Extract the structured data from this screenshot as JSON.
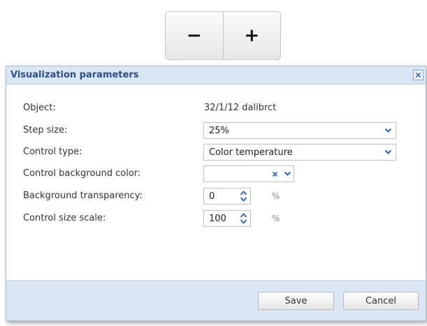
{
  "stepper": {
    "minus_label": "−",
    "plus_label": "+"
  },
  "dialog": {
    "title": "Visualization parameters",
    "fields": {
      "object": {
        "label": "Object:",
        "value": "32/1/12 dalibrct"
      },
      "step_size": {
        "label": "Step size:",
        "value": "25%"
      },
      "control_type": {
        "label": "Control type:",
        "value": "Color temperature"
      },
      "bg_color": {
        "label": "Control background color:",
        "value": ""
      },
      "bg_transparency": {
        "label": "Background transparency:",
        "value": "0",
        "unit": "%"
      },
      "size_scale": {
        "label": "Control size scale:",
        "value": "100",
        "unit": "%"
      }
    },
    "buttons": {
      "save": "Save",
      "cancel": "Cancel"
    }
  },
  "colors": {
    "title_bar": "#dbe6f4",
    "title_text": "#2c4f85",
    "footer": "#dbe6f4",
    "icon_blue": "#3c6aa8"
  },
  "icons": {
    "close": "close-icon",
    "dropdown": "chevron-down-icon",
    "clear": "clear-x-icon",
    "spin": "spin-up-down-icon"
  }
}
